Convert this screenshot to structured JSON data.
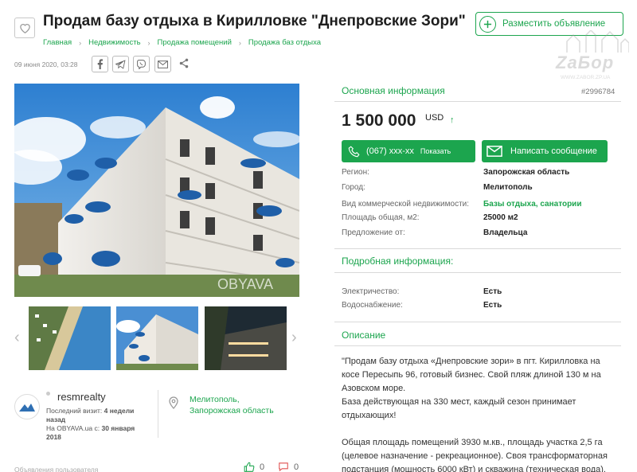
{
  "header": {
    "title": "Продам базу отдыха в Кирилловке \"Днепровские Зори\"",
    "breadcrumbs": [
      "Главная",
      "Недвижимость",
      "Продажа помещений",
      "Продажа баз отдыха"
    ],
    "post_ad_label": "Разместить объявление"
  },
  "watermark": {
    "brand": "ZaБор",
    "url": "WWW.ZABOR.ZP.UA"
  },
  "meta": {
    "date": "09 июня 2020, 03:28",
    "share_icons": [
      "facebook-icon",
      "telegram-icon",
      "viber-icon",
      "email-icon",
      "share-icon"
    ]
  },
  "gallery": {
    "photo_watermark": "OBYAVA",
    "thumbnails": [
      "beach-aerial",
      "building-front",
      "building-night"
    ]
  },
  "seller": {
    "name": "resmrealty",
    "last_visit_label": "Последний визит:",
    "last_visit_value": "4 недели назад",
    "since_label": "На OBYAVA.ua с:",
    "since_value": "30 января 2018",
    "location_line1": "Мелитополь,",
    "location_line2": "Запорожская область"
  },
  "bottom": {
    "hint": "Объявления пользователя",
    "likes": "0",
    "comments": "0"
  },
  "info": {
    "section_title": "Основная информация",
    "ad_id": "#2996784",
    "price": "1 500 000",
    "currency": "USD",
    "phone": "(067) xxx-xx",
    "show_label": "Показать",
    "message_label": "Написать сообщение",
    "rows": [
      {
        "label": "Регион:",
        "value": "Запорожская область"
      },
      {
        "label": "Город:",
        "value": "Мелитополь"
      },
      {
        "label": "Вид коммерческой недвижимости:",
        "value": "Базы отдыха, санатории"
      },
      {
        "label": "Площадь общая, м2:",
        "value": "25000 м2"
      },
      {
        "label": "Предложение от:",
        "value": "Владельца"
      }
    ]
  },
  "details": {
    "section_title": "Подробная информация:",
    "rows": [
      {
        "label": "Электричество:",
        "value": "Есть"
      },
      {
        "label": "Водоснабжение:",
        "value": "Есть"
      }
    ]
  },
  "description": {
    "section_title": "Описание",
    "paragraphs": [
      "\"Продам базу отдыха «Днепровские зори» в пгт. Кирилловка на косе Пересыпь 96, готовый бизнес. Свой пляж длиной 130 м на Азовском море.\nБаза действующая на 330 мест, каждый сезон принимает отдыхающих!",
      "Общая площадь помещений 3930 м.кв., площадь участка 2,5 га (целевое назначение - рекреационное). Своя трансформаторная подстанция (мощность 6000 кВт) и скважина (техническая вода)."
    ]
  }
}
